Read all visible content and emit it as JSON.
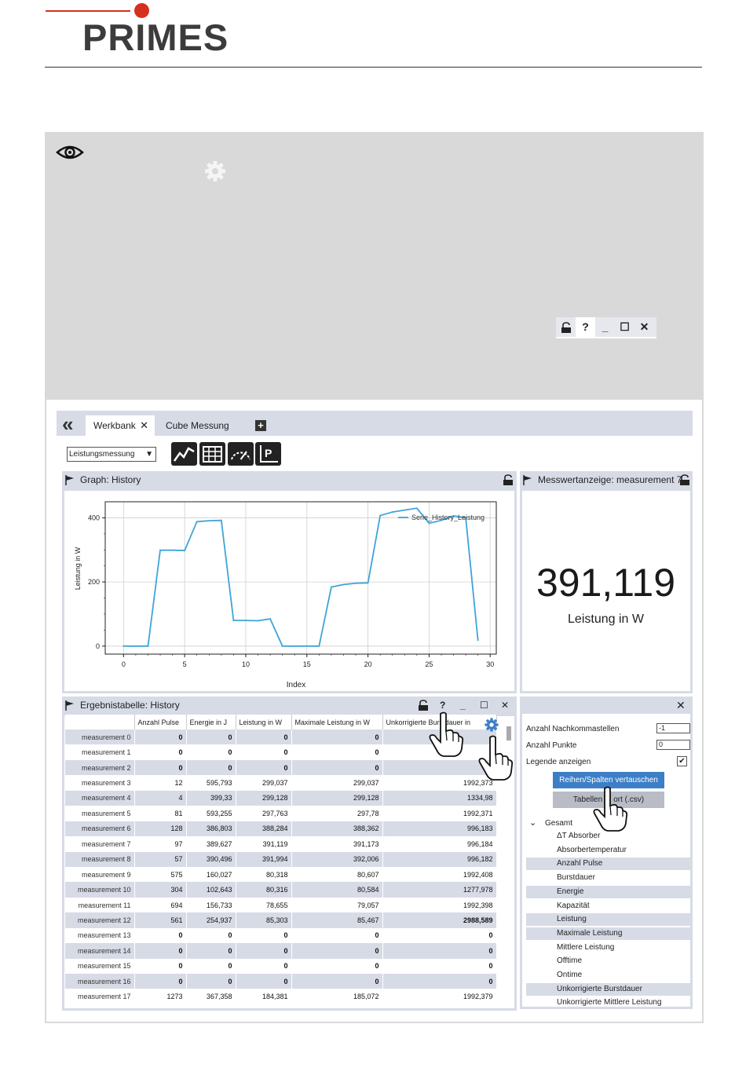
{
  "header": {
    "brand": "PRIMES"
  },
  "colors": {
    "brand_red": "#d6301f",
    "panel_blue": "#d7dbe6",
    "accent_blue": "#3d7fc6",
    "chart_line": "#3fa4d8"
  },
  "tabs": {
    "active": "Werkbank",
    "inactive": "Cube Messung"
  },
  "toolbar": {
    "mode": "Leistungsmessung"
  },
  "graph_panel": {
    "title": "Graph: History"
  },
  "value_panel": {
    "title": "Messwertanzeige: measurement 7",
    "value": "391,119",
    "unit": "Leistung in W"
  },
  "table_panel": {
    "title": "Ergebnistabelle: History"
  },
  "table": {
    "columns": [
      "",
      "Anzahl Pulse",
      "Energie in J",
      "Leistung in W",
      "Maximale Leistung in W",
      "Unkorrigierte Burstdauer in"
    ],
    "rows": [
      [
        "measurement 0",
        "0",
        "0",
        "0",
        "0",
        ""
      ],
      [
        "measurement 1",
        "0",
        "0",
        "0",
        "0",
        ""
      ],
      [
        "measurement 2",
        "0",
        "0",
        "0",
        "0",
        ""
      ],
      [
        "measurement 3",
        "12",
        "595,793",
        "299,037",
        "299,037",
        "1992,373"
      ],
      [
        "measurement 4",
        "4",
        "399,33",
        "299,128",
        "299,128",
        "1334,98"
      ],
      [
        "measurement 5",
        "81",
        "593,255",
        "297,763",
        "297,78",
        "1992,371"
      ],
      [
        "measurement 6",
        "128",
        "386,803",
        "388,284",
        "388,362",
        "996,183"
      ],
      [
        "measurement 7",
        "97",
        "389,627",
        "391,119",
        "391,173",
        "996,184"
      ],
      [
        "measurement 8",
        "57",
        "390,496",
        "391,994",
        "392,006",
        "996,182"
      ],
      [
        "measurement 9",
        "575",
        "160,027",
        "80,318",
        "80,607",
        "1992,408"
      ],
      [
        "measurement 10",
        "304",
        "102,643",
        "80,316",
        "80,584",
        "1277,978"
      ],
      [
        "measurement 11",
        "694",
        "156,733",
        "78,655",
        "79,057",
        "1992,398"
      ],
      [
        "measurement 12",
        "561",
        "254,937",
        "85,303",
        "85,467",
        "2988,589"
      ],
      [
        "measurement 13",
        "0",
        "0",
        "0",
        "0",
        "0"
      ],
      [
        "measurement 14",
        "0",
        "0",
        "0",
        "0",
        "0"
      ],
      [
        "measurement 15",
        "0",
        "0",
        "0",
        "0",
        "0"
      ],
      [
        "measurement 16",
        "0",
        "0",
        "0",
        "0",
        "0"
      ],
      [
        "measurement 17",
        "1273",
        "367,358",
        "184,381",
        "185,072",
        "1992,379"
      ]
    ]
  },
  "settings": {
    "decimals_label": "Anzahl Nachkommastellen",
    "decimals_value": "-1",
    "points_label": "Anzahl Punkte",
    "points_value": "0",
    "legend_label": "Legende anzeigen",
    "legend_checked": true,
    "swap_button": "Reihen/Spalten vertauschen",
    "export_button": "Tabellenexport (.csv)",
    "export_visible_a": "Tabellen",
    "export_visible_b": "ort (.csv)",
    "tree_root": "Gesamt",
    "tree_items": [
      "ΔT Absorber",
      "Absorbertemperatur",
      "Anzahl Pulse",
      "Burstdauer",
      "Energie",
      "Kapazität",
      "Leistung",
      "Maximale Leistung",
      "Mittlere Leistung",
      "Offtime",
      "Ontime",
      "Unkorrigierte Burstdauer",
      "Unkorrigierte Mittlere Leistung"
    ]
  },
  "chart_data": {
    "type": "line",
    "xlabel": "Index",
    "ylabel": "Leistung in W",
    "xlim": [
      -1.5,
      30.5
    ],
    "ylim": [
      -25,
      450
    ],
    "xticks": [
      0,
      5,
      10,
      15,
      20,
      25,
      30
    ],
    "yticks": [
      0,
      200,
      400
    ],
    "grid": true,
    "legend_placement": "top-right",
    "series": [
      {
        "name": "Serie_History_Leistung",
        "x": [
          0,
          1,
          2,
          3,
          4,
          5,
          6,
          7,
          8,
          9,
          10,
          11,
          12,
          13,
          14,
          15,
          16,
          17,
          18,
          19,
          20,
          21,
          22,
          23,
          24,
          25,
          26,
          27,
          28,
          29
        ],
        "values": [
          0,
          0,
          0,
          299,
          299,
          298,
          388,
          391,
          392,
          80,
          80,
          79,
          85,
          0,
          0,
          0,
          0,
          184,
          192,
          196,
          197,
          407,
          418,
          424,
          430,
          383,
          392,
          406,
          400,
          18
        ]
      }
    ]
  }
}
